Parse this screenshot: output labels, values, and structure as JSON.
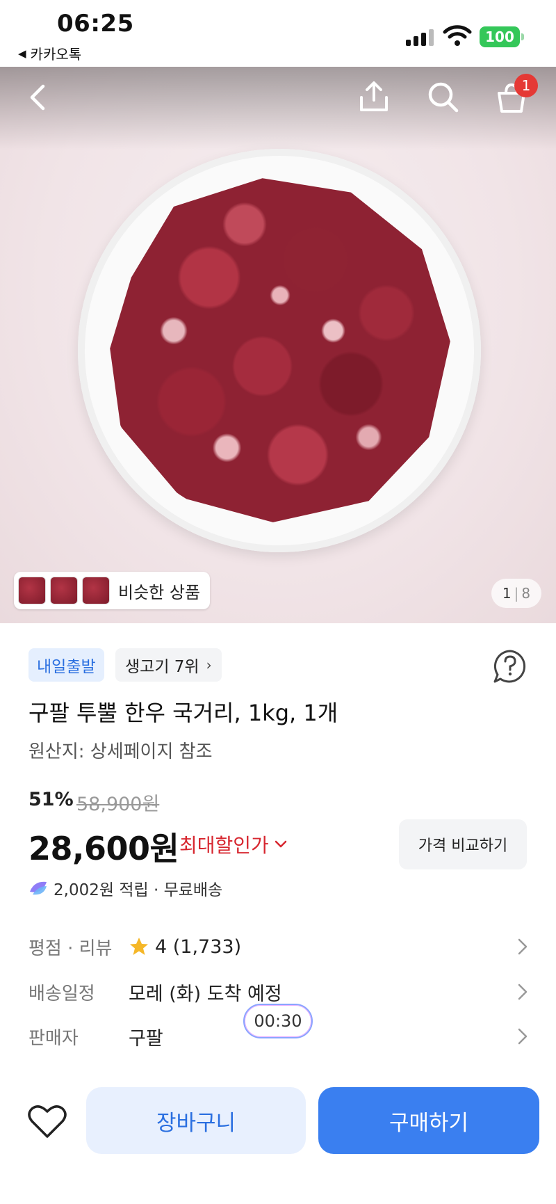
{
  "status_bar": {
    "time": "06:25",
    "back_app": "카카오톡",
    "battery": "100"
  },
  "hero": {
    "similar_label": "비슷한 상품",
    "counter_current": "1",
    "counter_total": "8",
    "cart_badge": "1"
  },
  "product": {
    "tag_delivery": "내일출발",
    "tag_rank": "생고기 7위",
    "title": "구팔 투뿔 한우 국거리, 1kg, 1개",
    "origin": "원산지: 상세페이지 참조",
    "discount_rate": "51%",
    "original_price": "58,900원",
    "price": "28,600원",
    "max_discount_label": "최대할인가",
    "compare_label": "가격 비교하기",
    "points_text": "2,002원 적립 · 무료배송"
  },
  "info": {
    "rating_label": "평점 · 리뷰",
    "rating_value": "4 (1,733)",
    "delivery_label": "배송일정",
    "delivery_value": "모레 (화) 도착 예정",
    "seller_label": "판매자",
    "seller_value": "구팔"
  },
  "timer": "00:30",
  "bottom": {
    "cart_label": "장바구니",
    "buy_label": "구매하기"
  },
  "colors": {
    "accent_blue": "#3a7ff0",
    "discount_red": "#d7262f",
    "star": "#f5b728",
    "tag_blue_bg": "#e5effe"
  }
}
